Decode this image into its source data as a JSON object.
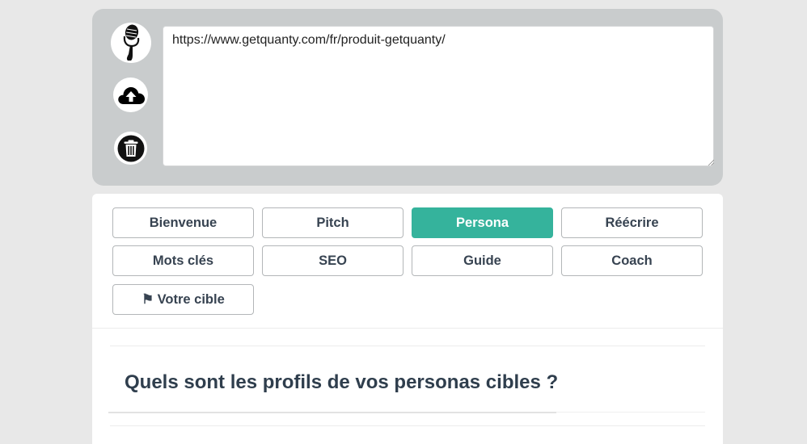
{
  "input": {
    "value": "https://www.getquanty.com/fr/produit-getquanty/"
  },
  "icons": {
    "mic": "microphone-icon",
    "upload": "cloud-upload-icon",
    "trash": "trash-icon"
  },
  "tabs": [
    {
      "label": "Bienvenue",
      "active": false
    },
    {
      "label": "Pitch",
      "active": false
    },
    {
      "label": "Persona",
      "active": true
    },
    {
      "label": "Réécrire",
      "active": false
    },
    {
      "label": "Mots clés",
      "active": false
    },
    {
      "label": "SEO",
      "active": false
    },
    {
      "label": "Guide",
      "active": false
    },
    {
      "label": "Coach",
      "active": false
    },
    {
      "label": "⚑ Votre cible",
      "active": false
    }
  ],
  "section": {
    "question": "Quels sont les profils de vos personas cibles ?"
  },
  "colors": {
    "accent": "#35b39c",
    "panel": "#c9cccd",
    "text": "#374351"
  }
}
